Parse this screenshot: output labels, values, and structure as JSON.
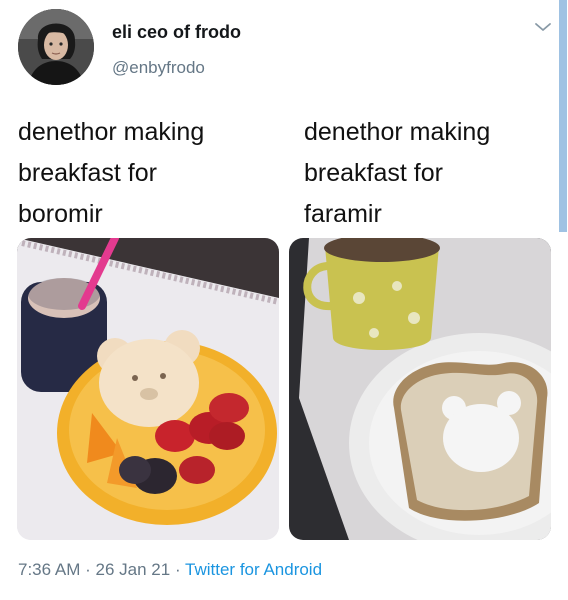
{
  "tweet": {
    "author_name": "eli ceo of frodo",
    "author_handle": "@enbyfrodo",
    "caption_left": [
      "denethor making",
      "breakfast for",
      "boromir"
    ],
    "caption_right": [
      "denethor making",
      "breakfast for",
      "faramir"
    ],
    "time": "7:36 AM",
    "separator": "·",
    "date": "26 Jan 21",
    "source": "Twitter for Android"
  },
  "colors": {
    "link": "#1b95e0",
    "muted": "#657786",
    "text": "#14171a"
  },
  "icons": {
    "menu": "chevron-down-icon"
  }
}
